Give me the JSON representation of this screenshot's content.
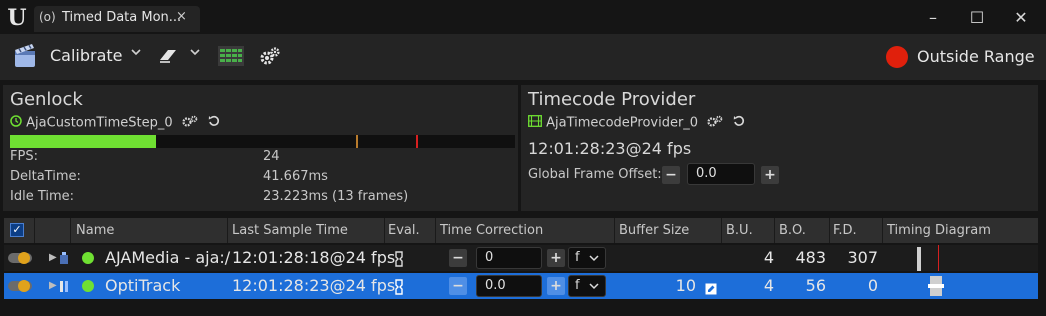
{
  "window": {
    "tab_title": "Timed Data Mon...",
    "tab_icon": "(o)",
    "tab_close": "×",
    "minimize": "–",
    "maximize": "☐",
    "close": "✕"
  },
  "toolbar": {
    "calibrate_label": "Calibrate",
    "dropdown_chevron": "⌄",
    "status_label": "Outside Range",
    "status_color": "#e0200c"
  },
  "genlock": {
    "title": "Genlock",
    "source_name": "AjaCustomTimeStep_0",
    "buffer_fill_fraction": 0.29,
    "stats": [
      {
        "label": "FPS:",
        "value": "24"
      },
      {
        "label": "DeltaTime:",
        "value": "41.667ms"
      },
      {
        "label": "Idle Time:",
        "value": "23.223ms (13 frames)"
      }
    ]
  },
  "timecode_provider": {
    "title": "Timecode Provider",
    "source_name": "AjaTimecodeProvider_0",
    "timecode": "12:01:28:23@24 fps",
    "global_frame_offset_label": "Global Frame Offset:",
    "global_frame_offset_value": "0.0"
  },
  "table": {
    "headers": {
      "name": "Name",
      "last_sample_time": "Last Sample Time",
      "eval": "Eval.",
      "time_correction": "Time Correction",
      "buffer_size": "Buffer Size",
      "bu": "B.U.",
      "bo": "B.O.",
      "fd": "F.D.",
      "timing": "Timing Diagram"
    },
    "rows": [
      {
        "name": "AJAMedia - aja:/",
        "last_sample_time": "12:01:28:18@24 fps",
        "time_correction": "0",
        "unit": "f",
        "buffer_size": "",
        "bu": "4",
        "bo": "483",
        "fd": "307"
      },
      {
        "name": "OptiTrack",
        "last_sample_time": "12:01:28:23@24 fps",
        "time_correction": "0.0",
        "unit": "f",
        "buffer_size": "10",
        "bu": "4",
        "bo": "56",
        "fd": "0"
      }
    ]
  },
  "colors": {
    "selected_row": "#1d6ed9",
    "ok_green": "#6fe032",
    "warning_red": "#e0200c",
    "toggle_amber": "#e0a21c"
  }
}
